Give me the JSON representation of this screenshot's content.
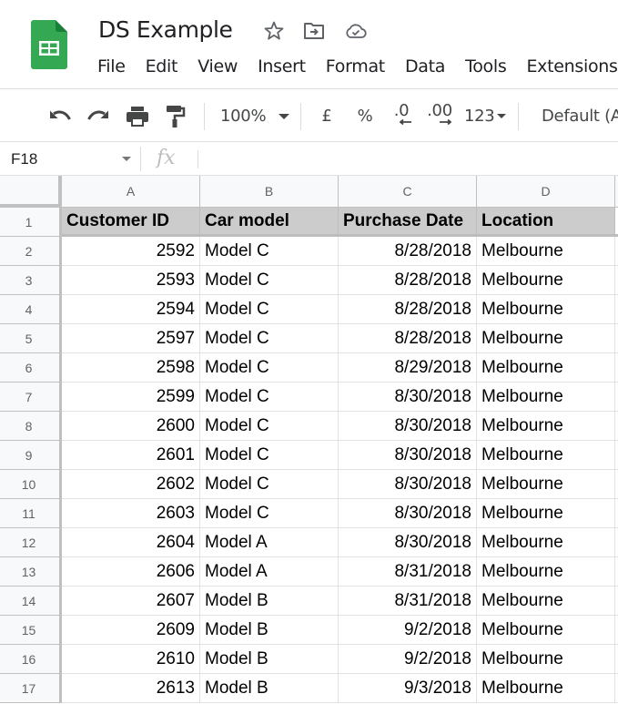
{
  "app": {
    "doc_title": "DS Example",
    "title_icons": [
      "star-icon",
      "move-to-folder-icon",
      "cloud-saved-icon"
    ],
    "brand_color": "#34a853"
  },
  "menu": [
    "File",
    "Edit",
    "View",
    "Insert",
    "Format",
    "Data",
    "Tools",
    "Extensions"
  ],
  "toolbar": {
    "undo": "undo-icon",
    "redo": "redo-icon",
    "print": "print-icon",
    "paint_format": "paint-format-icon",
    "zoom": "100%",
    "currency": "£",
    "percent": "%",
    "decrease_decimal": ".0",
    "increase_decimal": ".00",
    "more_formats": "123",
    "font": "Default (Ar"
  },
  "formula_bar": {
    "name_box": "F18",
    "fx_label": "fx",
    "formula": ""
  },
  "grid": {
    "columns": [
      "A",
      "B",
      "C",
      "D"
    ],
    "header_fill": "#cccccc",
    "rows": [
      {
        "num": "1",
        "cells": [
          "Customer ID",
          "Car model",
          "Purchase Date",
          "Location"
        ]
      },
      {
        "num": "2",
        "cells": [
          "2592",
          "Model C",
          "8/28/2018",
          "Melbourne"
        ]
      },
      {
        "num": "3",
        "cells": [
          "2593",
          "Model C",
          "8/28/2018",
          "Melbourne"
        ]
      },
      {
        "num": "4",
        "cells": [
          "2594",
          "Model C",
          "8/28/2018",
          "Melbourne"
        ]
      },
      {
        "num": "5",
        "cells": [
          "2597",
          "Model C",
          "8/28/2018",
          "Melbourne"
        ]
      },
      {
        "num": "6",
        "cells": [
          "2598",
          "Model C",
          "8/29/2018",
          "Melbourne"
        ]
      },
      {
        "num": "7",
        "cells": [
          "2599",
          "Model C",
          "8/30/2018",
          "Melbourne"
        ]
      },
      {
        "num": "8",
        "cells": [
          "2600",
          "Model C",
          "8/30/2018",
          "Melbourne"
        ]
      },
      {
        "num": "9",
        "cells": [
          "2601",
          "Model C",
          "8/30/2018",
          "Melbourne"
        ]
      },
      {
        "num": "10",
        "cells": [
          "2602",
          "Model C",
          "8/30/2018",
          "Melbourne"
        ]
      },
      {
        "num": "11",
        "cells": [
          "2603",
          "Model C",
          "8/30/2018",
          "Melbourne"
        ]
      },
      {
        "num": "12",
        "cells": [
          "2604",
          "Model A",
          "8/30/2018",
          "Melbourne"
        ]
      },
      {
        "num": "13",
        "cells": [
          "2606",
          "Model A",
          "8/31/2018",
          "Melbourne"
        ]
      },
      {
        "num": "14",
        "cells": [
          "2607",
          "Model B",
          "8/31/2018",
          "Melbourne"
        ]
      },
      {
        "num": "15",
        "cells": [
          "2609",
          "Model B",
          "9/2/2018",
          "Melbourne"
        ]
      },
      {
        "num": "16",
        "cells": [
          "2610",
          "Model B",
          "9/2/2018",
          "Melbourne"
        ]
      },
      {
        "num": "17",
        "cells": [
          "2613",
          "Model B",
          "9/3/2018",
          "Melbourne"
        ]
      }
    ]
  }
}
